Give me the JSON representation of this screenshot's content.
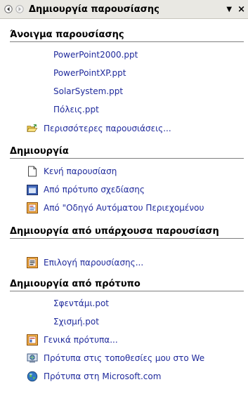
{
  "header": {
    "back_icon": "back-arrow-icon",
    "forward_icon": "forward-arrow-icon",
    "title": "Δημιουργία παρουσίασης",
    "menu_glyph": "▼",
    "close_glyph": "×"
  },
  "open_section": {
    "title": "Άνοιγμα παρουσίασης",
    "files": [
      "PowerPoint2000.ppt",
      "PowerPointXP.ppt",
      "SolarSystem.ppt",
      "Πόλεις.ppt"
    ],
    "more": "Περισσότερες παρουσιάσεις..."
  },
  "new_section": {
    "title": "Δημιουργία",
    "blank": "Κενή παρουσίαση",
    "design_template": "Από πρότυπο σχεδίασης",
    "autocontent_wizard": "Από \"Οδηγό Αυτόματου Περιεχομένου"
  },
  "existing_section": {
    "title": "Δημιουργία από υπάρχουσα παρουσίαση",
    "choose": "Επιλογή παρουσίασης..."
  },
  "template_section": {
    "title": "Δημιουργία από πρότυπο",
    "recent": [
      "Σφεντάμι.pot",
      "Σχισμή.pot"
    ],
    "general": "Γενικά πρότυπα...",
    "my_websites": "Πρότυπα στις τοποθεσίες μου στο We",
    "microsoft": "Πρότυπα στη Microsoft.com"
  },
  "colors": {
    "link": "#1f2a9c",
    "titlebar": "#e9e8e3"
  }
}
